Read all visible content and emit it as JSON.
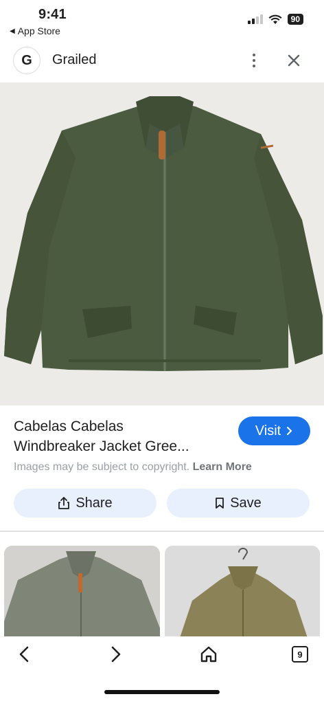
{
  "status": {
    "time": "9:41",
    "back_app": "App Store",
    "battery": "90",
    "back_arrow": "◀"
  },
  "header": {
    "avatar_letter": "G",
    "site_name": "Grailed"
  },
  "result": {
    "title_line1": "Cabelas Cabelas",
    "title_line2": "Windbreaker Jacket Gree...",
    "visit_label": "Visit",
    "copyright_text": "Images may be subject to copyright.",
    "learn_more": "Learn More"
  },
  "actions": {
    "share_label": "Share",
    "save_label": "Save"
  },
  "nav": {
    "tabs_count": "9"
  },
  "colors": {
    "accent": "#1a73e8",
    "action_bg": "#e8f0fe",
    "jacket_green": "#4a5a3e"
  },
  "icons": [
    "more-vert-icon",
    "close-icon",
    "chevron-right-icon",
    "share-icon",
    "bookmark-icon",
    "back-arrow-icon",
    "forward-arrow-icon",
    "home-icon",
    "tabs-icon"
  ]
}
